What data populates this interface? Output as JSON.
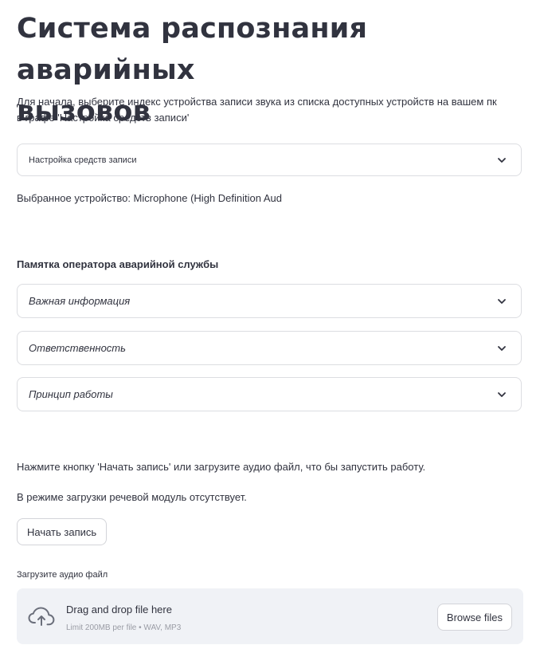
{
  "header": {
    "title_line1": "Система распознания аварийных",
    "title_line2": "вызовов"
  },
  "intro": {
    "line1": "Для начала, выберите индекс устройства записи звука из списка доступных устройств на вашем пк",
    "line2": "в графе 'Настройка средств записи'"
  },
  "device_expander": {
    "label": "Настройка средств записи"
  },
  "selected_device": "Выбранное устройство: Microphone (High Definition Aud",
  "memo": {
    "heading": "Памятка оператора аварийной службы",
    "items": [
      {
        "label": "Важная информация"
      },
      {
        "label": "Ответственность"
      },
      {
        "label": "Принцип работы"
      }
    ]
  },
  "instructions": {
    "line1": "Нажмите кнопку 'Начать запись' или загрузите аудио файл, что бы запустить работу.",
    "line2": "В режиме загрузки речевой модуль отсутствует."
  },
  "record_button": {
    "label": "Начать запись"
  },
  "uploader": {
    "label": "Загрузите аудио файл",
    "title": "Drag and drop file here",
    "subtitle": "Limit 200MB per file • WAV, MP3",
    "browse_label": "Browse files",
    "icon": "cloud-upload-icon"
  },
  "colors": {
    "text": "#31333f",
    "border": "#dcdde1",
    "dropzone_bg": "#f0f2f6",
    "muted": "#9a9ca5"
  }
}
